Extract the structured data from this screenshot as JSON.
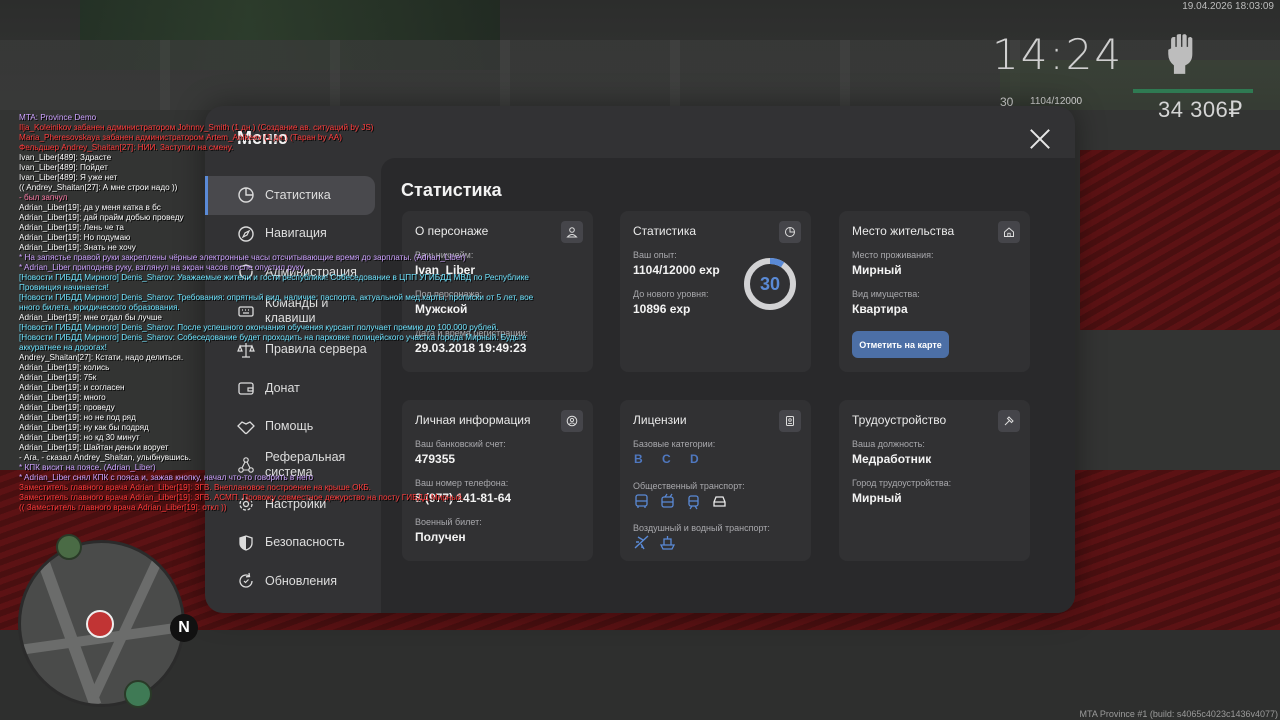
{
  "hud": {
    "datetime": "19.04.2026 18:03:09",
    "time": "14:24",
    "level": "30",
    "exp": "1104/12000",
    "money": "34 306₽",
    "build": "MTA Province #1 (build: s4065c4023c1436v4077)"
  },
  "menu": {
    "title": "Меню",
    "nav": [
      {
        "label": "Статистика",
        "icon": "pie-chart-icon",
        "active": true
      },
      {
        "label": "Навигация",
        "icon": "compass-icon"
      },
      {
        "label": "Администрация",
        "icon": "shield-icon"
      },
      {
        "label": "Команды и клавиши",
        "icon": "keyboard-icon"
      },
      {
        "label": "Правила сервера",
        "icon": "scales-icon"
      },
      {
        "label": "Донат",
        "icon": "wallet-icon"
      },
      {
        "label": "Помощь",
        "icon": "handshake-icon"
      },
      {
        "label": "Реферальная система",
        "icon": "network-icon"
      },
      {
        "label": "Настройки",
        "icon": "gear-icon"
      },
      {
        "label": "Безопасность",
        "icon": "shield-half-icon"
      },
      {
        "label": "Обновления",
        "icon": "refresh-icon"
      }
    ]
  },
  "stats": {
    "title": "Статистика",
    "character": {
      "title": "О персонаже",
      "nickname_label": "Ваш никнейм:",
      "nickname": "Ivan_Liber",
      "gender_label": "Пол персонажа:",
      "gender": "Мужской",
      "reg_label": "Дата и время регистрации:",
      "reg": "29.03.2018 19:49:23"
    },
    "statistics": {
      "title": "Статистика",
      "exp_label": "Ваш опыт:",
      "exp": "1104/12000 exp",
      "next_label": "До нового уровня:",
      "next": "10896 exp",
      "level": "30",
      "progress": 0.092
    },
    "residence": {
      "title": "Место жительства",
      "place_label": "Место проживания:",
      "place": "Мирный",
      "property_label": "Вид имущества:",
      "property": "Квартира",
      "map_button": "Отметить на карте"
    },
    "personal": {
      "title": "Личная информация",
      "bank_label": "Ваш банковский счет:",
      "bank": "479355",
      "phone_label": "Ваш номер телефона:",
      "phone": "8 (977) 141-81-64",
      "military_label": "Военный билет:",
      "military": "Получен"
    },
    "licenses": {
      "title": "Лицензии",
      "base_label": "Базовые категории:",
      "base": "B C D",
      "public_label": "Общественный транспорт:",
      "air_label": "Воздушный и водный транспорт:"
    },
    "job": {
      "title": "Трудоустройство",
      "position_label": "Ваша должность:",
      "position": "Медработник",
      "city_label": "Город трудоустройства:",
      "city": "Мирный"
    }
  },
  "chat": [
    {
      "c": "c-violet",
      "t": "MTA: Province Demo"
    },
    {
      "c": "c-red",
      "t": "Ilja_Koleinikov забанен администратором Johnny_Smith (1 дн.) (Создание ав. ситуаций by JS)"
    },
    {
      "c": "c-red",
      "t": "Maria_Pheresovskaya забанен администратором Artem_Anikeev (1 дн.) (Таран by AA)"
    },
    {
      "c": "c-red",
      "t": "Фельдшер Andrey_Shaitan[27]: НИИ. Заступил на смену."
    },
    {
      "c": "c-white",
      "t": "Ivan_Liber[489]: Здрасте"
    },
    {
      "c": "c-white",
      "t": "Ivan_Liber[489]: Пойдет"
    },
    {
      "c": "c-white",
      "t": "Ivan_Liber[489]: Я уже нет"
    },
    {
      "c": "c-white",
      "t": "(( Andrey_Shaitan[27]: А мне строи надо ))"
    },
    {
      "c": "c-pink",
      "t": "- был запчул"
    },
    {
      "c": "c-white",
      "t": "Adrian_Liber[19]: да у меня катка в бс"
    },
    {
      "c": "c-white",
      "t": "Adrian_Liber[19]: дай прайм добью проведу"
    },
    {
      "c": "c-white",
      "t": "Adrian_Liber[19]: Лень че та"
    },
    {
      "c": "c-white",
      "t": "Adrian_Liber[19]: Но подумаю"
    },
    {
      "c": "c-white",
      "t": "Adrian_Liber[19]: Знать не хочу"
    },
    {
      "c": "c-violet",
      "t": " * На запястье правой руки закреплены чёрные электронные часы отсчитывающие время до зарплаты. (Adrian_Liber)"
    },
    {
      "c": "c-violet",
      "t": " * Adrian_Liber приподняв руку, взглянул на экран часов после опустил руку"
    },
    {
      "c": "c-cyan",
      "t": "[Новости ГИБДД Мирного] Denis_Sharov: Уважаемые жители и гости республики! Собеседование в ЦПП УГИБДД МВД по Республике"
    },
    {
      "c": "c-cyan",
      "t": " Провинция начинается!"
    },
    {
      "c": "c-cyan",
      "t": "[Новости ГИБДД Мирного] Denis_Sharov: Требования: опрятный вид, наличие: паспорта, актуальной мед.карты, прописки от 5 лет, вое"
    },
    {
      "c": "c-cyan",
      "t": "нного билета, юридического образования."
    },
    {
      "c": "c-white",
      "t": "Adrian_Liber[19]: мне отдал бы лучше"
    },
    {
      "c": "c-cyan",
      "t": "[Новости ГИБДД Мирного] Denis_Sharov: После успешного окончания обучения курсант получает премию до 100.000 рублей."
    },
    {
      "c": "c-cyan",
      "t": "[Новости ГИБДД Мирного] Denis_Sharov: Собеседование будет проходить на парковке полицейского участка города Мирный. Будьте"
    },
    {
      "c": "c-cyan",
      "t": " аккуратнее на дорогах!"
    },
    {
      "c": "c-white",
      "t": "Andrey_Shaitan[27]: Кстати, надо делиться."
    },
    {
      "c": "c-white",
      "t": "Adrian_Liber[19]: колись"
    },
    {
      "c": "c-white",
      "t": "Adrian_Liber[19]: 75к"
    },
    {
      "c": "c-white",
      "t": "Adrian_Liber[19]: и согласен"
    },
    {
      "c": "c-white",
      "t": "Adrian_Liber[19]: много"
    },
    {
      "c": "c-white",
      "t": "Adrian_Liber[19]: проведу"
    },
    {
      "c": "c-white",
      "t": "Adrian_Liber[19]: но не под ряд"
    },
    {
      "c": "c-white",
      "t": "Adrian_Liber[19]: ну как бы подряд"
    },
    {
      "c": "c-white",
      "t": "Adrian_Liber[19]: но кд 30 минут"
    },
    {
      "c": "c-white",
      "t": "Adrian_Liber[19]: Шайтан деньги ворует"
    },
    {
      "c": "c-white",
      "t": " - Ага, - сказал Andrey_Shaitan, улыбнувшись."
    },
    {
      "c": "c-violet",
      "t": " * КПК висит на поясе. (Adrian_Liber)"
    },
    {
      "c": "c-violet",
      "t": " * Adrian_Liber снял КПК с пояса и, зажав кнопку, начал что-то говорить в него"
    },
    {
      "c": "c-red",
      "t": "Заместитель главного врача Adrian_Liber[19]: ЗГВ. Внеплановое построение на крыше ОКБ."
    },
    {
      "c": "c-red",
      "t": "Заместитель главного врача Adrian_Liber[19]: ЗГВ. АСМП. Провожу совместное дежурство на посту ГИБДД Мирный."
    },
    {
      "c": "c-red",
      "t": "(( Заместитель главного врача Adrian_Liber[19]: откл ))"
    }
  ],
  "minimap": {
    "north": "N"
  },
  "colors": {
    "accent": "#5a8ad6",
    "button": "#4c6fa6",
    "panel": "#323234",
    "card": "#313133"
  }
}
